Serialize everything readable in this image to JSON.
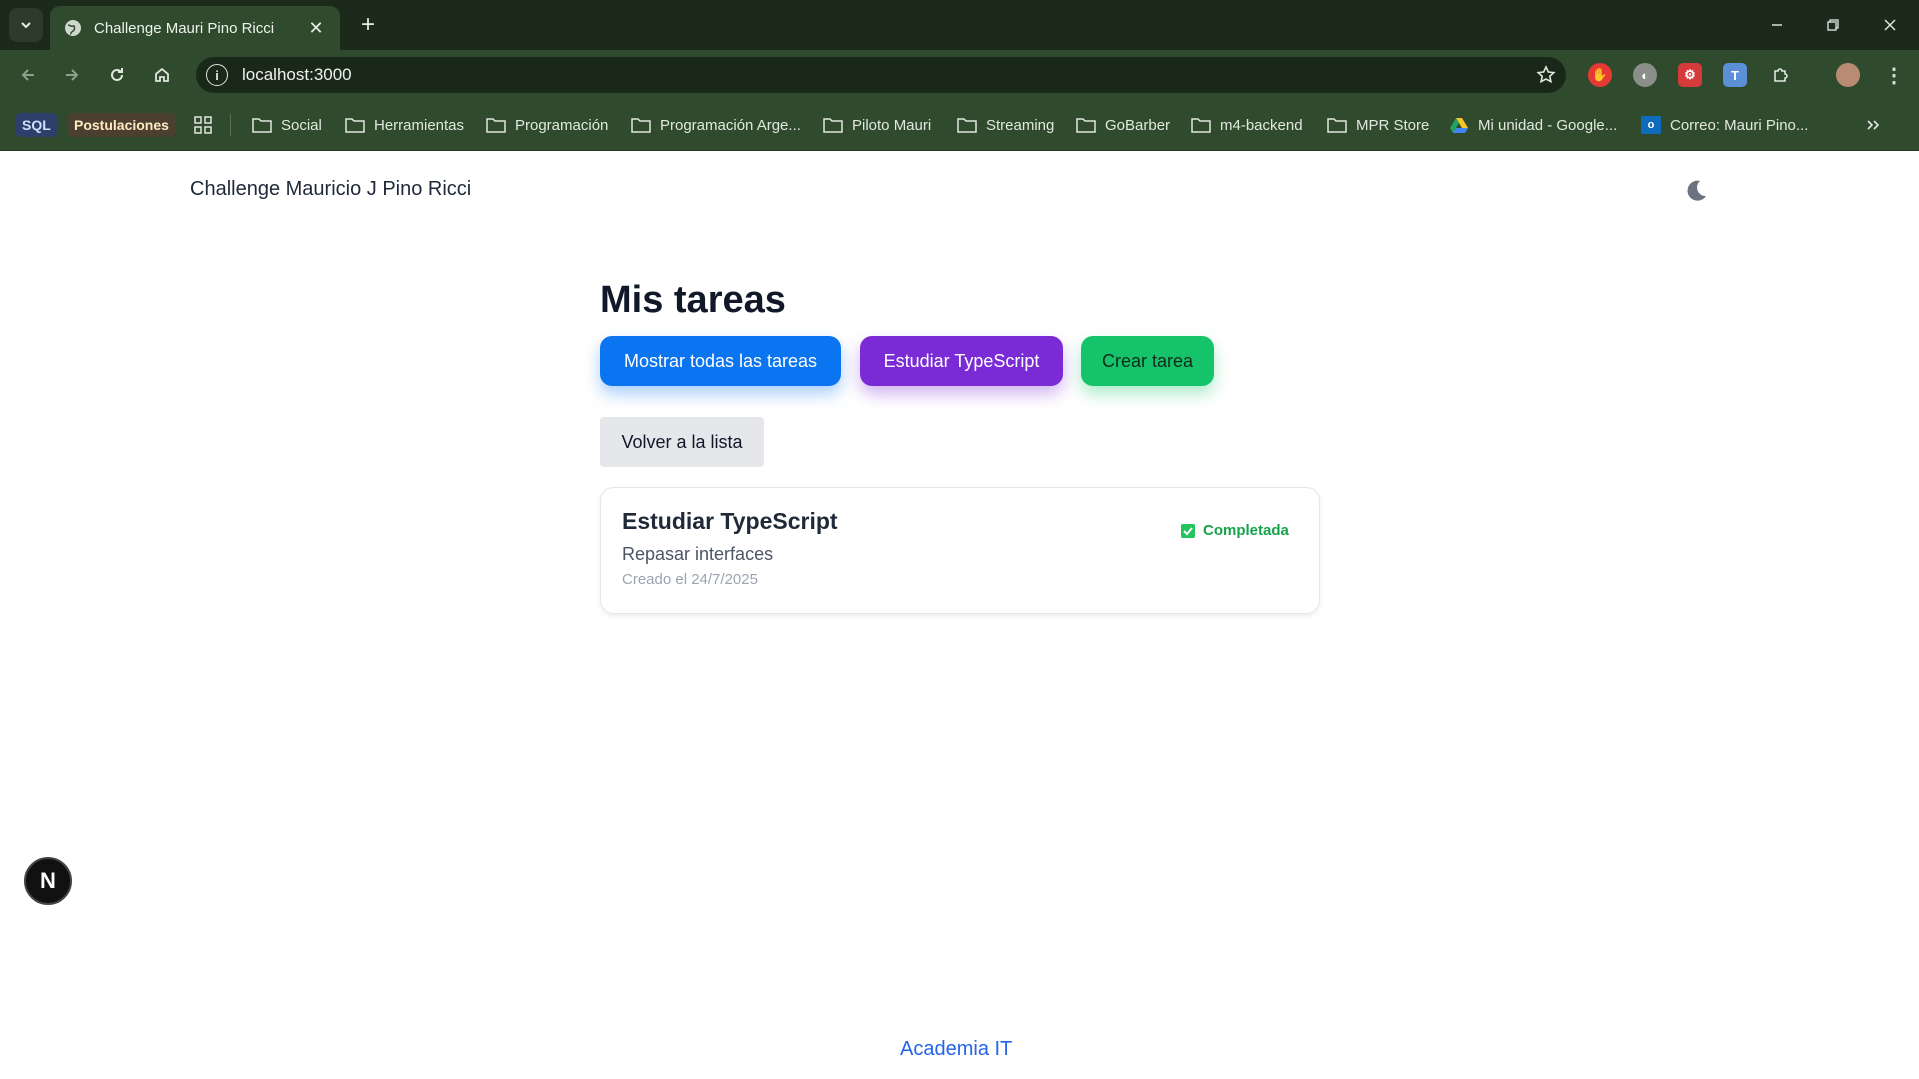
{
  "browser": {
    "tab_title": "Challenge Mauri Pino Ricci",
    "url": "localhost:3000",
    "bookmarks": {
      "sql": "SQL",
      "postulaciones": "Postulaciones",
      "items": [
        "Social",
        "Herramientas",
        "Programación",
        "Programación Arge...",
        "Piloto Mauri",
        "Streaming",
        "GoBarber",
        "m4-backend",
        "MPR Store",
        "Mi unidad - Google...",
        "Correo: Mauri Pino..."
      ]
    }
  },
  "header": {
    "title": "Challenge Mauricio J Pino Ricci"
  },
  "main": {
    "heading": "Mis tareas",
    "buttons": {
      "show_all": "Mostrar todas las tareas",
      "filter": "Estudiar TypeScript",
      "create": "Crear tarea",
      "back": "Volver a la lista"
    },
    "task": {
      "title": "Estudiar TypeScript",
      "description": "Repasar interfaces",
      "created": "Creado el 24/7/2025",
      "status": "Completada"
    }
  },
  "footer": {
    "link": "Academia IT"
  },
  "badge": {
    "letter": "N"
  },
  "colors": {
    "chrome_dark": "#1c2a1c",
    "chrome": "#2f4a2c",
    "blue": "#0b74f1",
    "purple": "#7a2bd6",
    "green": "#15c46a",
    "completed": "#16a34a"
  }
}
